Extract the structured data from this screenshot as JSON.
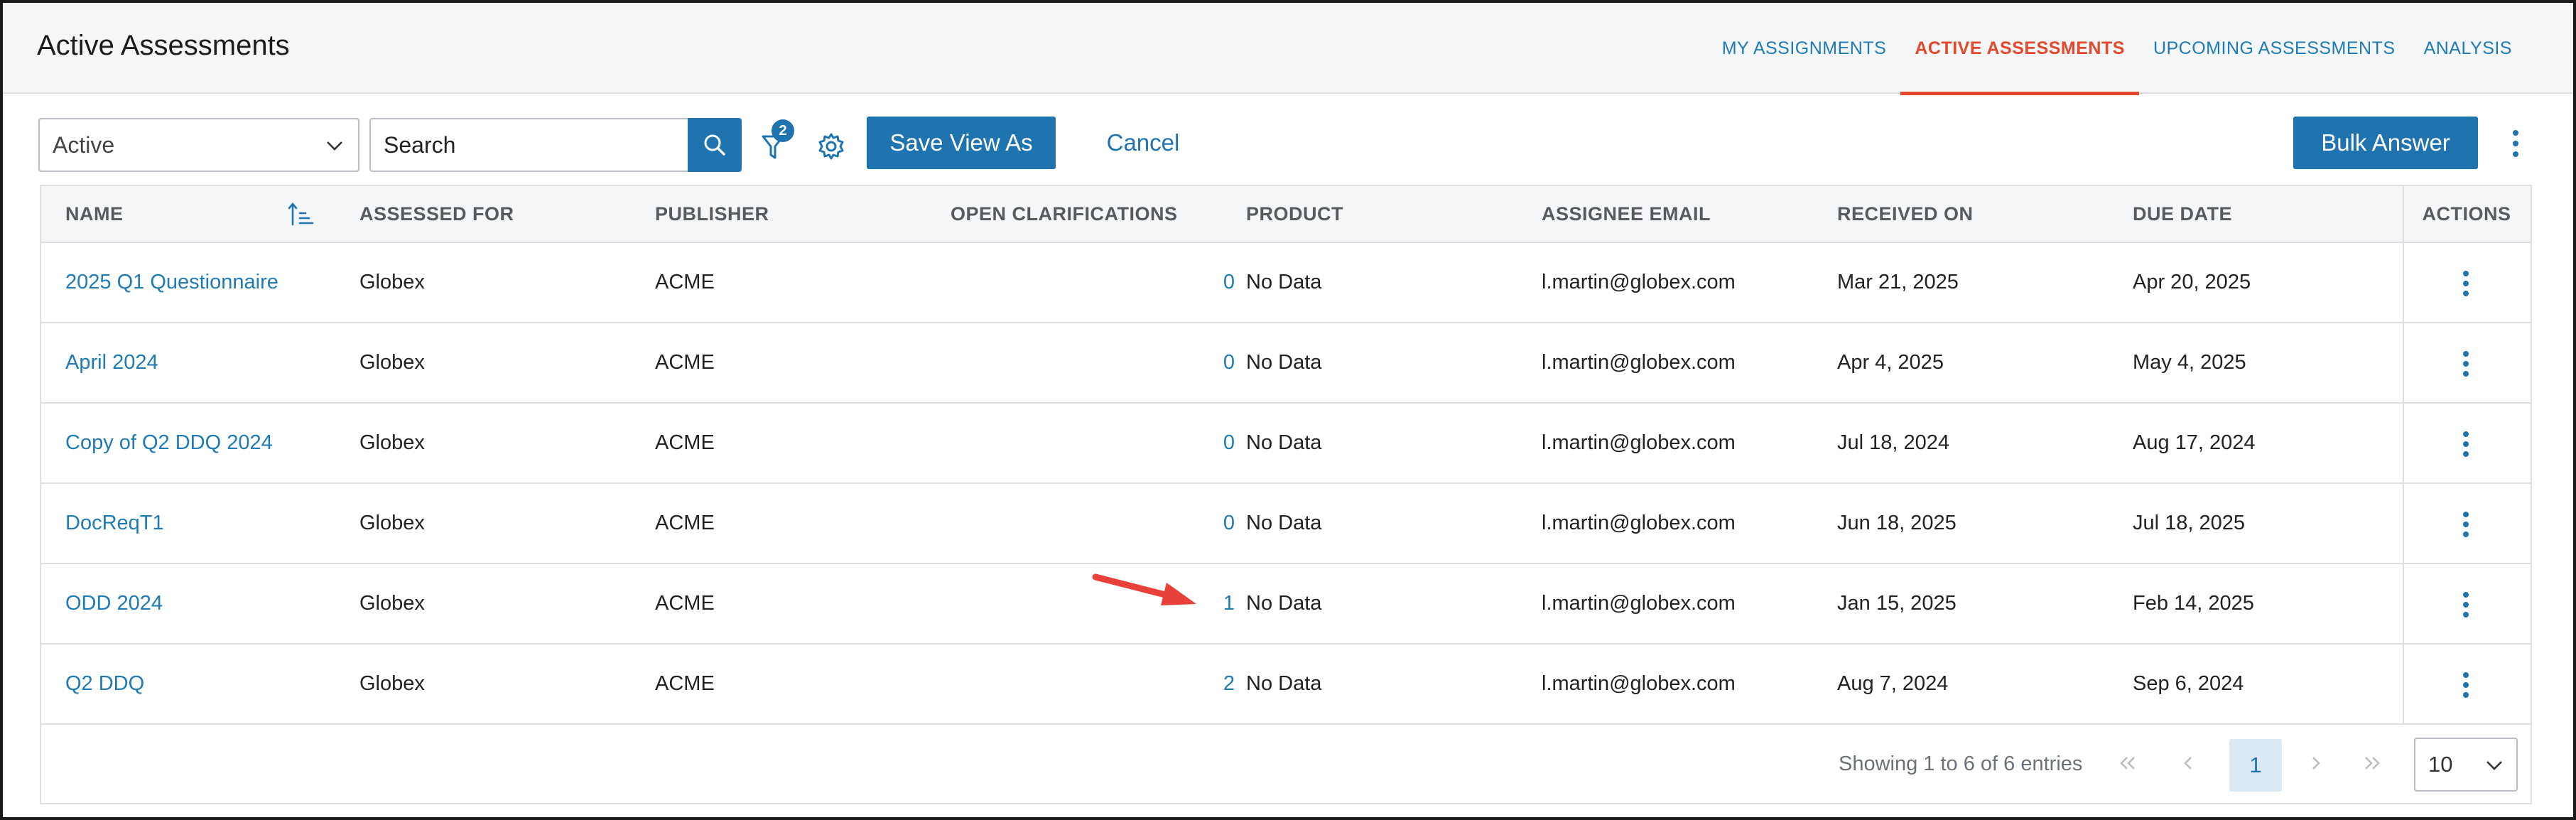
{
  "header": {
    "title": "Active Assessments",
    "tabs": [
      {
        "label": "MY ASSIGNMENTS",
        "active": false
      },
      {
        "label": "ACTIVE ASSESSMENTS",
        "active": true
      },
      {
        "label": "UPCOMING ASSESSMENTS",
        "active": false
      },
      {
        "label": "ANALYSIS",
        "active": false
      }
    ]
  },
  "toolbar": {
    "status_select": "Active",
    "search_placeholder": "Search",
    "filter_count": "2",
    "save_view_label": "Save View As",
    "cancel_label": "Cancel",
    "bulk_answer_label": "Bulk Answer"
  },
  "table": {
    "columns": [
      "NAME",
      "ASSESSED FOR",
      "PUBLISHER",
      "OPEN CLARIFICATIONS",
      "PRODUCT",
      "ASSIGNEE EMAIL",
      "RECEIVED ON",
      "DUE DATE",
      "ACTIONS"
    ],
    "rows": [
      {
        "name": "2025 Q1 Questionnaire",
        "assessed_for": "Globex",
        "publisher": "ACME",
        "open_clarifications": "0",
        "product": "No Data",
        "assignee_email": "l.martin@globex.com",
        "received_on": "Mar 21, 2025",
        "due_date": "Apr 20, 2025"
      },
      {
        "name": "April 2024",
        "assessed_for": "Globex",
        "publisher": "ACME",
        "open_clarifications": "0",
        "product": "No Data",
        "assignee_email": "l.martin@globex.com",
        "received_on": "Apr 4, 2025",
        "due_date": "May 4, 2025"
      },
      {
        "name": "Copy of Q2 DDQ 2024",
        "assessed_for": "Globex",
        "publisher": "ACME",
        "open_clarifications": "0",
        "product": "No Data",
        "assignee_email": "l.martin@globex.com",
        "received_on": "Jul 18, 2024",
        "due_date": "Aug 17, 2024"
      },
      {
        "name": "DocReqT1",
        "assessed_for": "Globex",
        "publisher": "ACME",
        "open_clarifications": "0",
        "product": "No Data",
        "assignee_email": "l.martin@globex.com",
        "received_on": "Jun 18, 2025",
        "due_date": "Jul 18, 2025"
      },
      {
        "name": "ODD 2024",
        "assessed_for": "Globex",
        "publisher": "ACME",
        "open_clarifications": "1",
        "product": "No Data",
        "assignee_email": "l.martin@globex.com",
        "received_on": "Jan 15, 2025",
        "due_date": "Feb 14, 2025"
      },
      {
        "name": "Q2 DDQ",
        "assessed_for": "Globex",
        "publisher": "ACME",
        "open_clarifications": "2",
        "product": "No Data",
        "assignee_email": "l.martin@globex.com",
        "received_on": "Aug 7, 2024",
        "due_date": "Sep 6, 2024"
      }
    ]
  },
  "pagination": {
    "info": "Showing 1 to 6 of 6 entries",
    "current_page": "1",
    "page_size": "10"
  },
  "colors": {
    "primary": "#1f74b0",
    "link": "#1f7bb6",
    "active_tab": "#e5492b",
    "annotation_arrow": "#e8413a"
  },
  "icons": [
    "chevron-down-icon",
    "search-icon",
    "filter-icon",
    "gear-icon",
    "kebab-icon",
    "sort-ascending-icon",
    "first-page-icon",
    "prev-page-icon",
    "next-page-icon",
    "last-page-icon"
  ]
}
